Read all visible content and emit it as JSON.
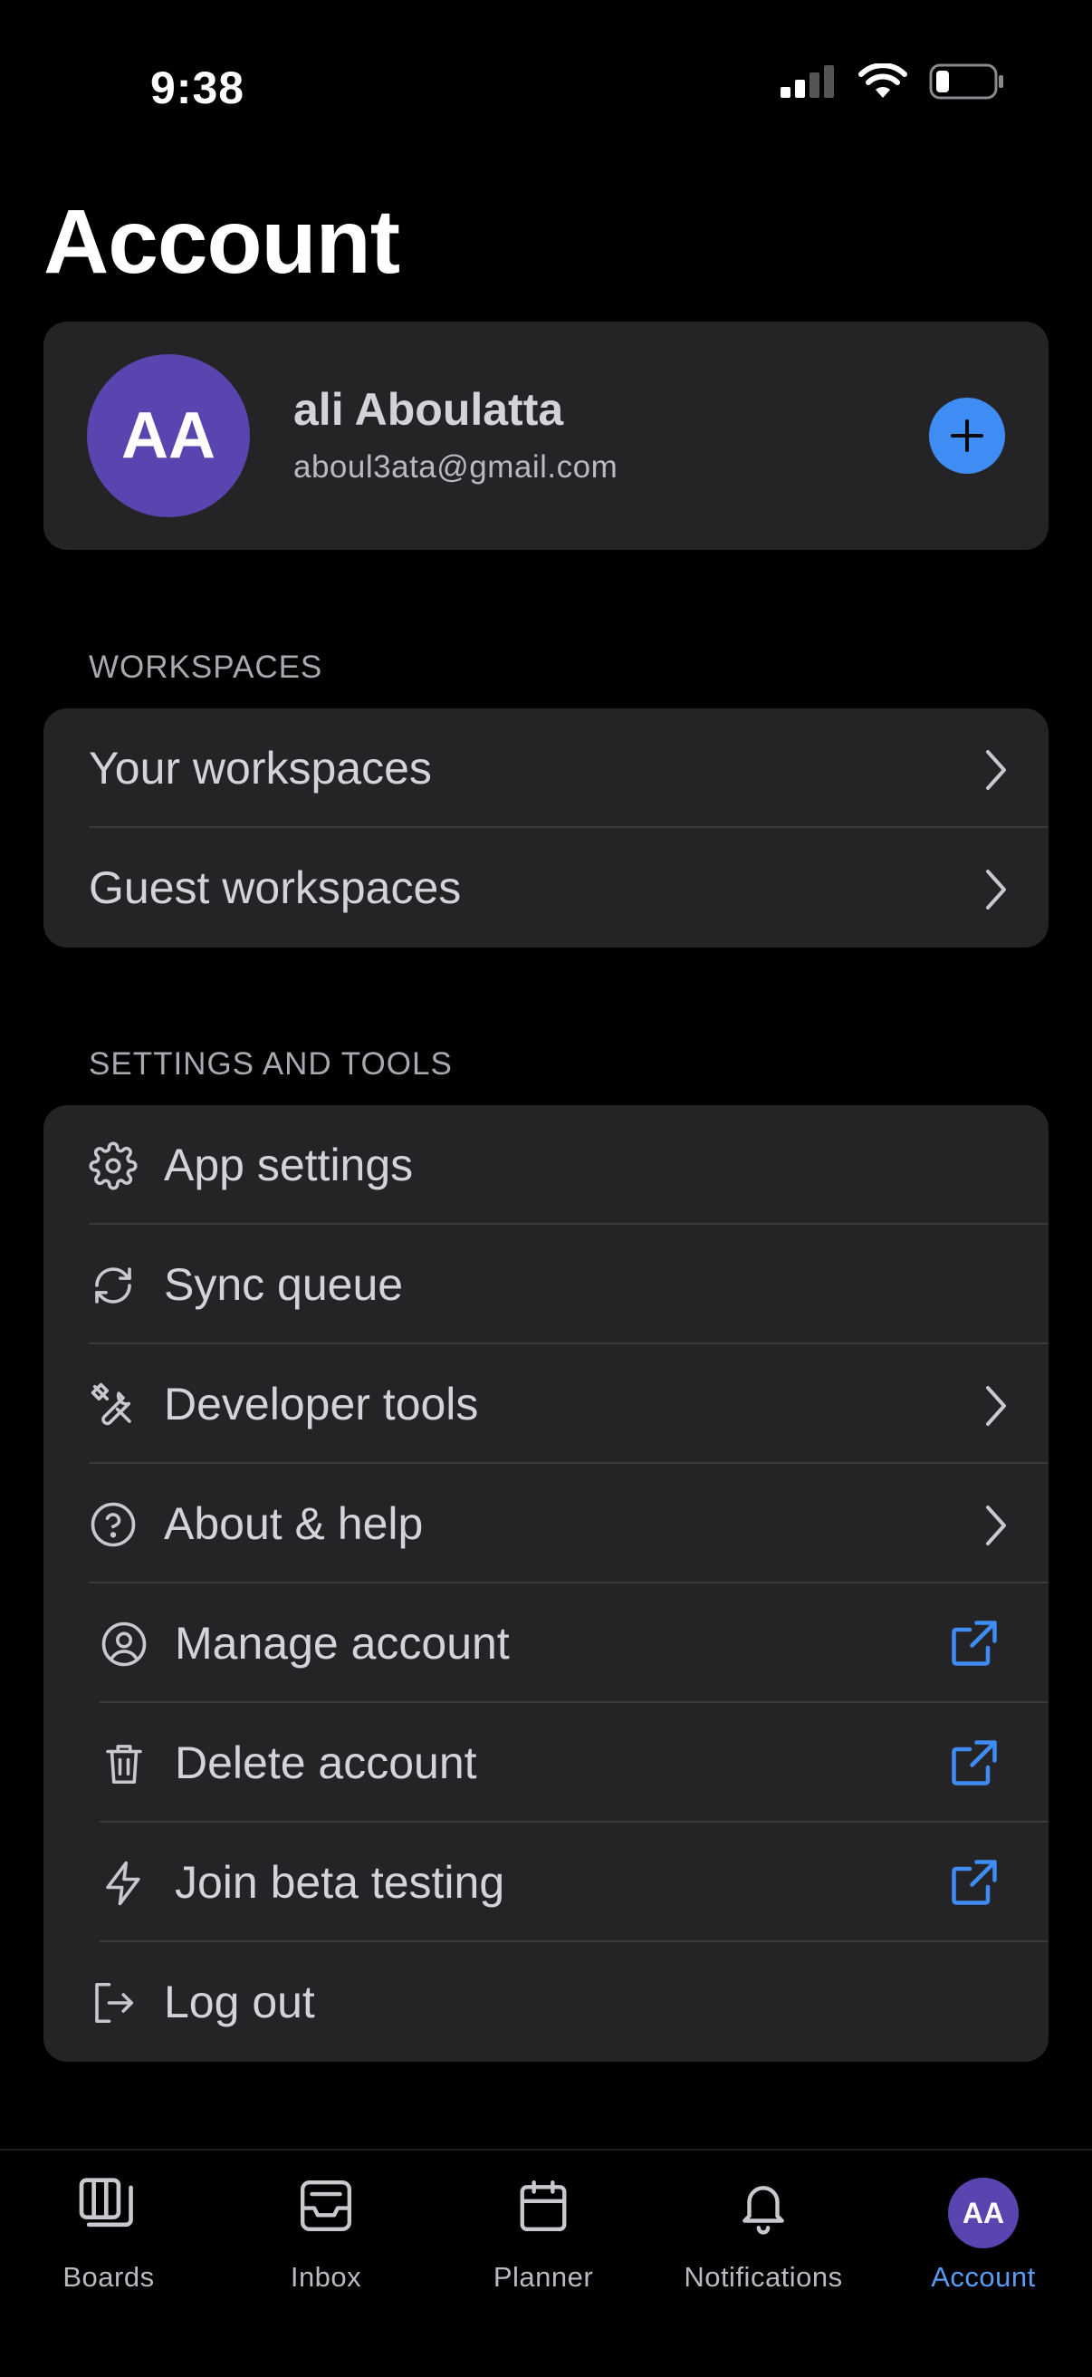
{
  "status": {
    "time": "9:38"
  },
  "page": {
    "title": "Account"
  },
  "profile": {
    "initials": "AA",
    "name": "ali Aboulatta",
    "email": "aboul3ata@gmail.com",
    "avatar_color": "#5a44b0",
    "add_icon": "plus-icon"
  },
  "workspaces": {
    "header": "WORKSPACES",
    "items": [
      {
        "label": "Your workspaces",
        "icon": "chevron-right-icon"
      },
      {
        "label": "Guest workspaces",
        "icon": "chevron-right-icon"
      }
    ]
  },
  "settings": {
    "header": "SETTINGS AND TOOLS",
    "items": [
      {
        "label": "App settings",
        "icon": "gear-icon"
      },
      {
        "label": "Sync queue",
        "icon": "sync-icon"
      },
      {
        "label": "Developer tools",
        "icon": "tools-icon",
        "trailing": "chevron-right-icon"
      },
      {
        "label": "About & help",
        "icon": "question-circle-icon",
        "trailing": "chevron-right-icon"
      },
      {
        "label": "Manage account",
        "icon": "user-circle-icon",
        "trailing": "external-link-icon"
      },
      {
        "label": "Delete account",
        "icon": "trash-icon",
        "trailing": "external-link-icon"
      },
      {
        "label": "Join beta testing",
        "icon": "bolt-icon",
        "trailing": "external-link-icon"
      },
      {
        "label": "Log out",
        "icon": "logout-icon"
      }
    ]
  },
  "tabbar": {
    "tabs": [
      {
        "label": "Boards",
        "icon": "boards-icon"
      },
      {
        "label": "Inbox",
        "icon": "inbox-icon"
      },
      {
        "label": "Planner",
        "icon": "calendar-icon"
      },
      {
        "label": "Notifications",
        "icon": "bell-icon"
      },
      {
        "label": "Account",
        "initials": "AA",
        "active": true
      }
    ]
  },
  "colors": {
    "accent": "#3f8cf5",
    "active_tab": "#5a9cf4",
    "card": "#242426"
  }
}
